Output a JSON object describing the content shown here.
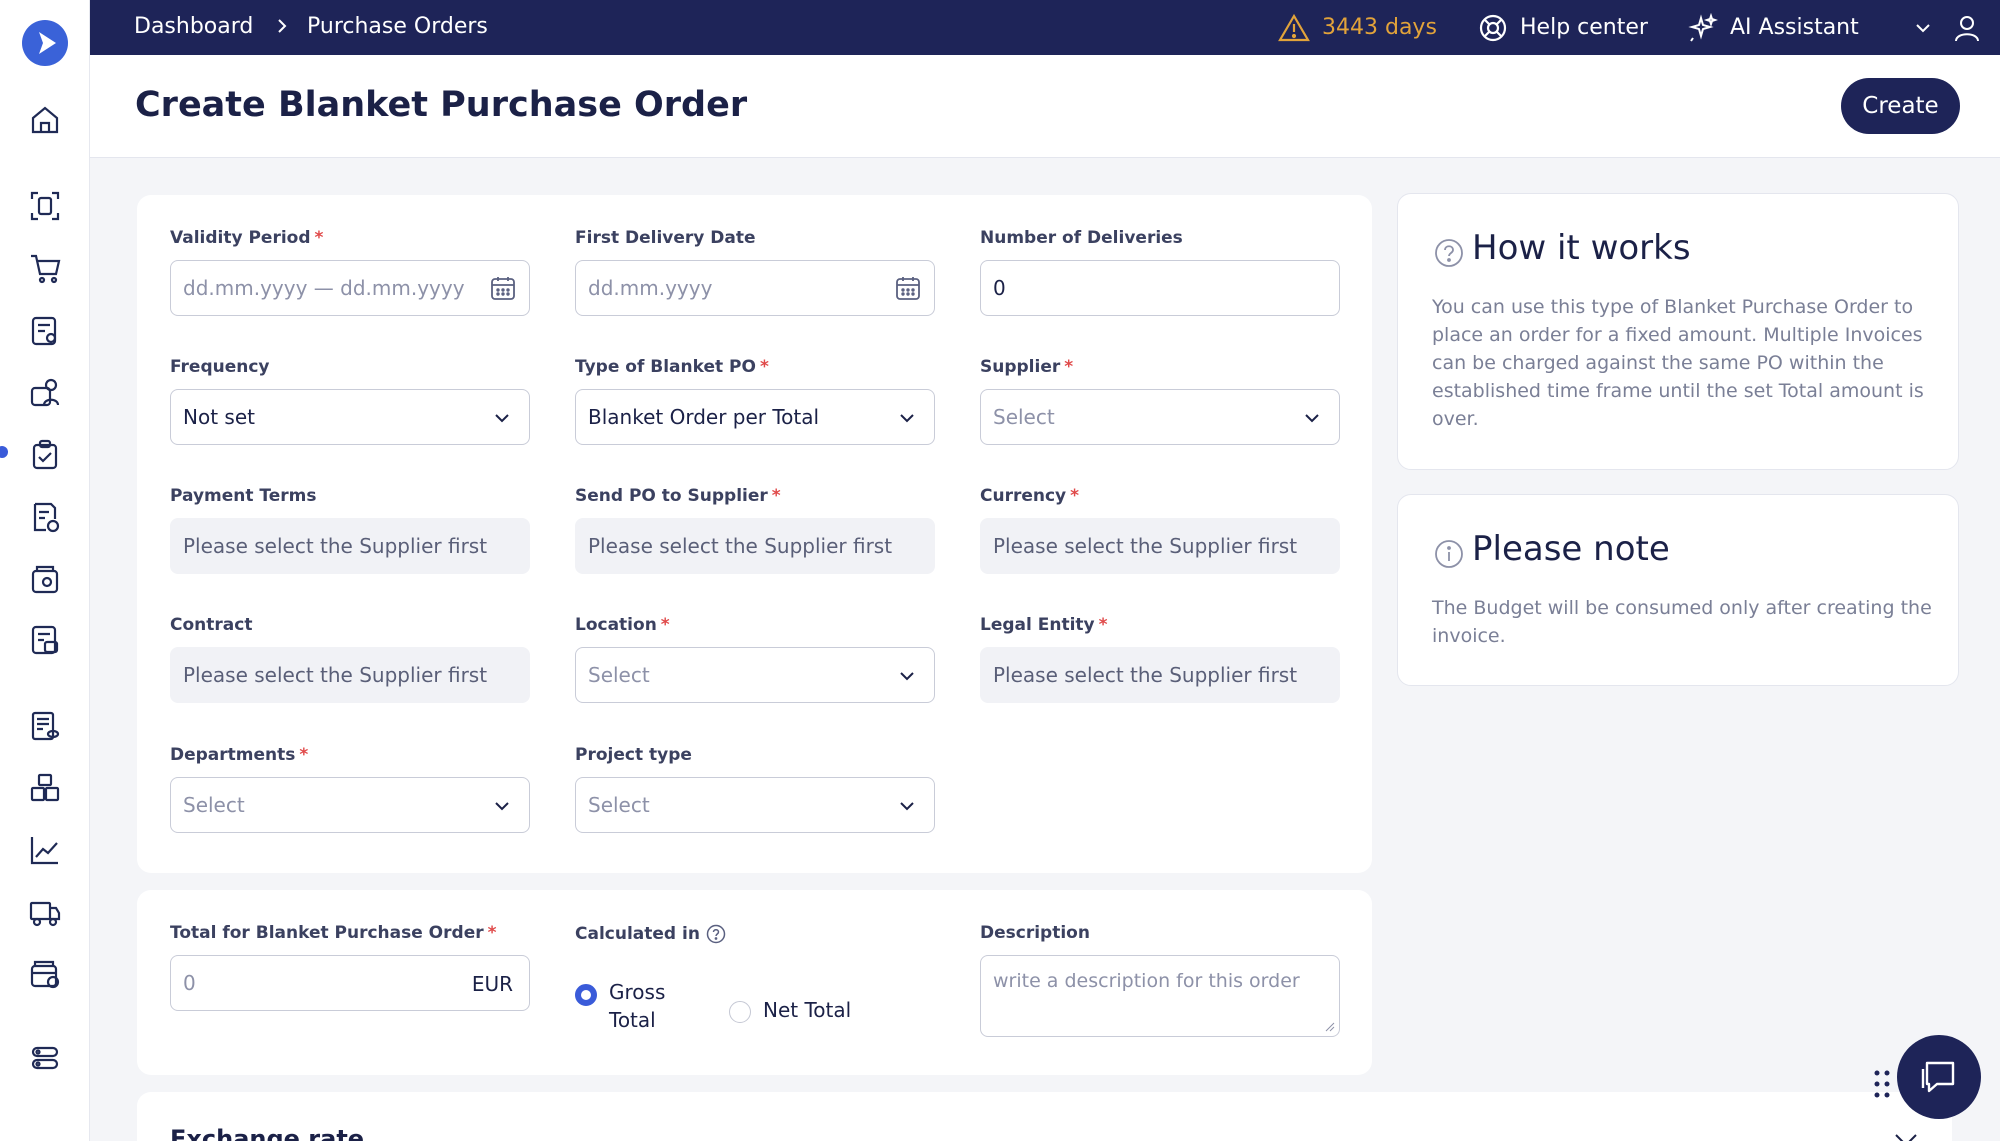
{
  "breadcrumb": {
    "home": "Dashboard",
    "current": "Purchase Orders"
  },
  "topbar": {
    "days": "3443 days",
    "help": "Help center",
    "ai": "AI Assistant"
  },
  "page": {
    "title": "Create Blanket Purchase Order",
    "create": "Create"
  },
  "form": {
    "validity": {
      "label": "Validity Period",
      "placeholder": "dd.mm.yyyy — dd.mm.yyyy"
    },
    "first_delivery": {
      "label": "First Delivery Date",
      "placeholder": "dd.mm.yyyy"
    },
    "num_deliveries": {
      "label": "Number of Deliveries",
      "value": "0"
    },
    "frequency": {
      "label": "Frequency",
      "value": "Not set"
    },
    "type": {
      "label": "Type of Blanket PO",
      "value": "Blanket Order per Total"
    },
    "supplier": {
      "label": "Supplier",
      "value": "Select"
    },
    "payment": {
      "label": "Payment Terms",
      "value": "Please select the Supplier first"
    },
    "send_po": {
      "label": "Send PO to Supplier",
      "value": "Please select the Supplier first"
    },
    "currency": {
      "label": "Currency",
      "value": "Please select the Supplier first"
    },
    "contract": {
      "label": "Contract",
      "value": "Please select the Supplier first"
    },
    "location": {
      "label": "Location",
      "value": "Select"
    },
    "legal": {
      "label": "Legal Entity",
      "value": "Please select the Supplier first"
    },
    "departments": {
      "label": "Departments",
      "value": "Select"
    },
    "project": {
      "label": "Project type",
      "value": "Select"
    }
  },
  "totals": {
    "total_label": "Total for Blanket Purchase Order",
    "total_value": "0",
    "currency": "EUR",
    "calc_label": "Calculated in",
    "gross_line1": "Gross",
    "gross_line2": "Total",
    "net": "Net Total",
    "desc_label": "Description",
    "desc_placeholder": "write a description for this order"
  },
  "exchange": {
    "title": "Exchange rate"
  },
  "how": {
    "title": "How it works",
    "body": "You can use this type of Blanket Purchase Order to place an order for a fixed amount. Multiple Invoices can be charged against the same PO within the established time frame until the set Total amount is over."
  },
  "note": {
    "title": "Please note",
    "body": "The Budget will be consumed only after creating the invoice."
  },
  "icons": {
    "sidebar": [
      "home-icon",
      "scan-icon",
      "cart-icon",
      "requests-icon",
      "team-icon",
      "orders-icon",
      "invoice-icon",
      "wallet-icon",
      "payments-icon",
      "ledger-icon",
      "boxes-icon",
      "analytics-icon",
      "delivery-icon",
      "archive-icon",
      "settings-icon"
    ]
  },
  "colors": {
    "navy": "#1e2458",
    "accent": "#3a5bd9",
    "warning": "#e2a33a",
    "required": "#e04a4a"
  }
}
